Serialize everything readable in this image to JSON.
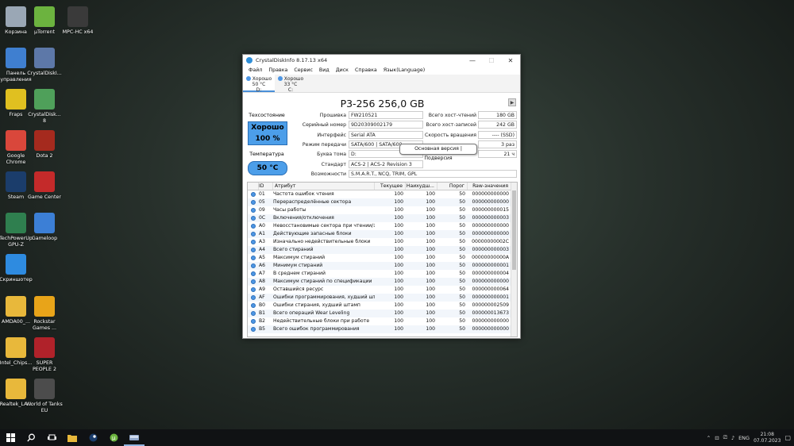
{
  "desktop": {
    "icons": [
      {
        "label": "Корзина",
        "icon": "recycle-bin-icon"
      },
      {
        "label": "µTorrent",
        "icon": "utorrent-icon"
      },
      {
        "label": "MPC-HC x64",
        "icon": "mpc-hc-icon"
      },
      {
        "label": "Панель управления",
        "icon": "control-panel-icon"
      },
      {
        "label": "CrystalDiskI...",
        "icon": "crystaldiskinfo-icon"
      },
      {
        "label": "Fraps",
        "icon": "fraps-icon"
      },
      {
        "label": "CrystalDisk... 8",
        "icon": "crystaldiskmark-icon"
      },
      {
        "label": "Google Chrome",
        "icon": "chrome-icon"
      },
      {
        "label": "Dota 2",
        "icon": "dota2-icon"
      },
      {
        "label": "Steam",
        "icon": "steam-icon"
      },
      {
        "label": "Game Center",
        "icon": "game-center-icon"
      },
      {
        "label": "TechPowerUp GPU-Z",
        "icon": "gpuz-icon"
      },
      {
        "label": "Gameloop",
        "icon": "gameloop-icon"
      },
      {
        "label": "Скриншотер",
        "icon": "screenshoter-icon"
      },
      {
        "label": "AMDA00_...",
        "icon": "folder-icon"
      },
      {
        "label": "Rockstar Games ...",
        "icon": "rockstar-icon"
      },
      {
        "label": "Intel_Chips...",
        "icon": "folder-icon"
      },
      {
        "label": "SUPER PEOPLE 2",
        "icon": "super-people-icon"
      },
      {
        "label": "Realtek_LA...",
        "icon": "folder-icon"
      },
      {
        "label": "World of Tanks EU",
        "icon": "wot-icon"
      }
    ]
  },
  "window": {
    "title": "CrystalDiskInfo 8.17.13 x64",
    "menu": [
      "Файл",
      "Правка",
      "Сервис",
      "Вид",
      "Диск",
      "Справка",
      "Язык(Language)"
    ],
    "drives": [
      {
        "status": "Хорошо",
        "temp": "50 °C",
        "letter": "D:"
      },
      {
        "status": "Хорошо",
        "temp": "33 °C",
        "letter": "C:"
      }
    ],
    "model": "P3-256 256,0 GB",
    "health": {
      "label": "Техсостояние",
      "status": "Хорошо",
      "percent": "100 %"
    },
    "temperature": {
      "label": "Температура",
      "value": "50 °C"
    },
    "info": {
      "firmware_label": "Прошивка",
      "firmware": "FW210521",
      "serial_label": "Серийный номер",
      "serial": "9D20309002179",
      "interface_label": "Интерфейс",
      "interface": "Serial ATA",
      "transfer_label": "Режим передачи",
      "transfer": "SATA/600 | SATA/600",
      "volume_label": "Буква тома",
      "volume": "D:",
      "standard_label": "Стандарт",
      "standard": "ACS-2 | ACS-2 Revision 3",
      "features_label": "Возможности",
      "features": "S.M.A.R.T., NCQ, TRIM, GPL",
      "host_reads_label": "Всего хост-чтений",
      "host_reads": "180 GB",
      "host_writes_label": "Всего хост-записей",
      "host_writes": "242 GB",
      "rotation_label": "Скорость вращения",
      "rotation": "---- (SSD)",
      "power_count": "3 раз",
      "power_hours": "21 ч"
    },
    "tooltip": "Основная версия | Подверсия",
    "table": {
      "headers": [
        "ID",
        "Атрибут",
        "Текущее",
        "Наихудш...",
        "Порог",
        "Raw-значения"
      ],
      "rows": [
        [
          "01",
          "Частота ошибок чтения",
          "100",
          "100",
          "50",
          "000000000000"
        ],
        [
          "05",
          "Перераспределённые сектора",
          "100",
          "100",
          "50",
          "000000000000"
        ],
        [
          "09",
          "Часы работы",
          "100",
          "100",
          "50",
          "000000000015"
        ],
        [
          "0C",
          "Включения/отключения",
          "100",
          "100",
          "50",
          "000000000003"
        ],
        [
          "A0",
          "Невосстановимые сектора при чтении/за...",
          "100",
          "100",
          "50",
          "000000000000"
        ],
        [
          "A1",
          "Действующие запасные блоки",
          "100",
          "100",
          "50",
          "000000000000"
        ],
        [
          "A3",
          "Изначально недействительные блоки",
          "100",
          "100",
          "50",
          "00000000002C"
        ],
        [
          "A4",
          "Всего стираний",
          "100",
          "100",
          "50",
          "000000000003"
        ],
        [
          "A5",
          "Максимум стираний",
          "100",
          "100",
          "50",
          "00000000000A"
        ],
        [
          "A6",
          "Минимум стираний",
          "100",
          "100",
          "50",
          "000000000001"
        ],
        [
          "A7",
          "В среднем стираний",
          "100",
          "100",
          "50",
          "000000000004"
        ],
        [
          "A8",
          "Максимум стираний по спецификации",
          "100",
          "100",
          "50",
          "000000000000"
        ],
        [
          "A9",
          "Оставшийся ресурс",
          "100",
          "100",
          "50",
          "000000000064"
        ],
        [
          "AF",
          "Ошибки программирования, худший шта...",
          "100",
          "100",
          "50",
          "000000000001"
        ],
        [
          "B0",
          "Ошибки стирания, худший штамп",
          "100",
          "100",
          "50",
          "000000002509"
        ],
        [
          "B1",
          "Всего операций Wear Leveling",
          "100",
          "100",
          "50",
          "000000013673"
        ],
        [
          "B2",
          "Недействительные блоки при работе",
          "100",
          "100",
          "50",
          "000000000000"
        ],
        [
          "B5",
          "Всего ошибок программирования",
          "100",
          "100",
          "50",
          "000000000000"
        ]
      ]
    }
  },
  "taskbar": {
    "lang": "ENG",
    "time": "21:08",
    "date": "07.07.2023"
  }
}
